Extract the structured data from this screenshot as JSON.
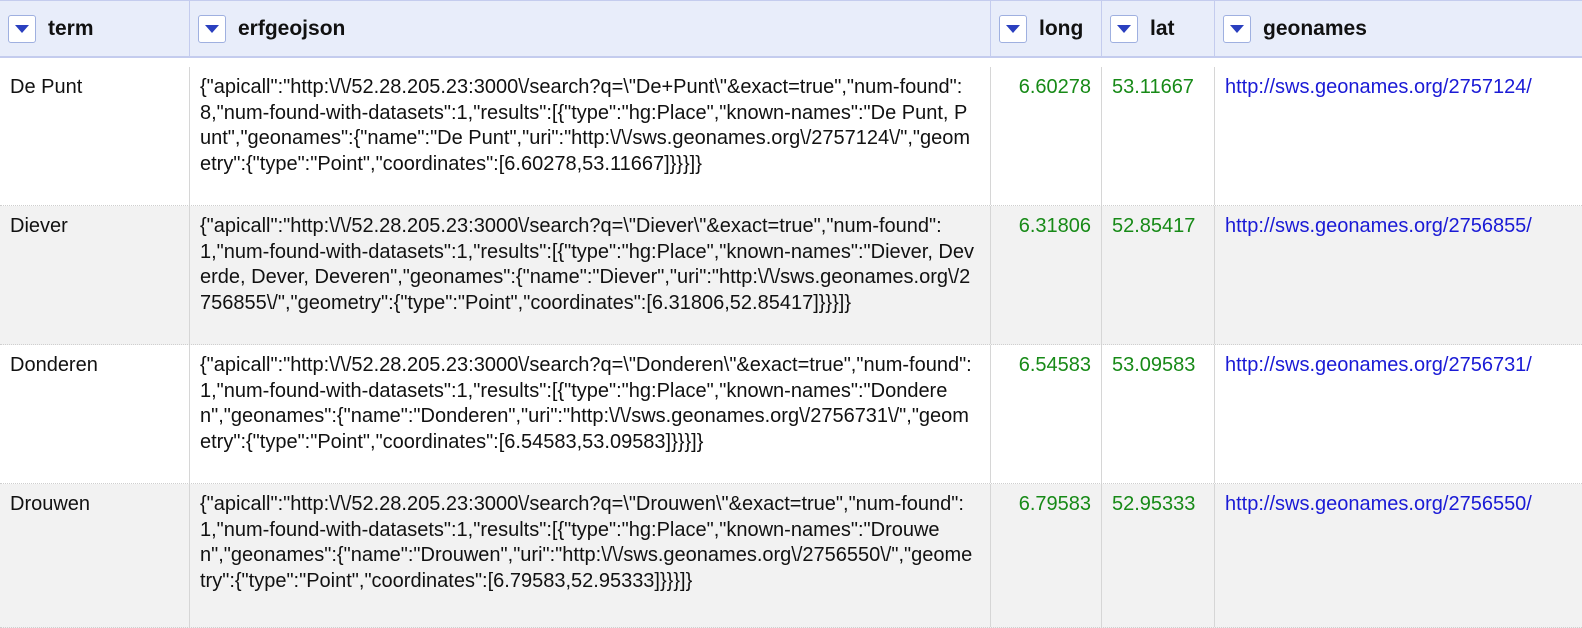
{
  "columns": [
    {
      "label": "term"
    },
    {
      "label": "erfgeojson"
    },
    {
      "label": "long"
    },
    {
      "label": "lat"
    },
    {
      "label": "geonames"
    }
  ],
  "rows": [
    {
      "term": "De Punt",
      "erfgeojson": "{\"apicall\":\"http:\\/\\/52.28.205.23:3000\\/search?q=\\\"De+Punt\\\"&exact=true\",\"num-found\":8,\"num-found-with-datasets\":1,\"results\":[{\"type\":\"hg:Place\",\"known-names\":\"De Punt, Punt\",\"geonames\":{\"name\":\"De Punt\",\"uri\":\"http:\\/\\/sws.geonames.org\\/2757124\\/\",\"geometry\":{\"type\":\"Point\",\"coordinates\":[6.60278,53.11667]}}}]}",
      "long": "6.60278",
      "lat": "53.11667",
      "geonames": "http://sws.geonames.org/2757124/"
    },
    {
      "term": "Diever",
      "erfgeojson": "{\"apicall\":\"http:\\/\\/52.28.205.23:3000\\/search?q=\\\"Diever\\\"&exact=true\",\"num-found\":1,\"num-found-with-datasets\":1,\"results\":[{\"type\":\"hg:Place\",\"known-names\":\"Diever, Deverde, Dever, Deveren\",\"geonames\":{\"name\":\"Diever\",\"uri\":\"http:\\/\\/sws.geonames.org\\/2756855\\/\",\"geometry\":{\"type\":\"Point\",\"coordinates\":[6.31806,52.85417]}}}]}",
      "long": "6.31806",
      "lat": "52.85417",
      "geonames": "http://sws.geonames.org/2756855/"
    },
    {
      "term": "Donderen",
      "erfgeojson": "{\"apicall\":\"http:\\/\\/52.28.205.23:3000\\/search?q=\\\"Donderen\\\"&exact=true\",\"num-found\":1,\"num-found-with-datasets\":1,\"results\":[{\"type\":\"hg:Place\",\"known-names\":\"Donderen\",\"geonames\":{\"name\":\"Donderen\",\"uri\":\"http:\\/\\/sws.geonames.org\\/2756731\\/\",\"geometry\":{\"type\":\"Point\",\"coordinates\":[6.54583,53.09583]}}}]}",
      "long": "6.54583",
      "lat": "53.09583",
      "geonames": "http://sws.geonames.org/2756731/"
    },
    {
      "term": "Drouwen",
      "erfgeojson": "{\"apicall\":\"http:\\/\\/52.28.205.23:3000\\/search?q=\\\"Drouwen\\\"&exact=true\",\"num-found\":1,\"num-found-with-datasets\":1,\"results\":[{\"type\":\"hg:Place\",\"known-names\":\"Drouwen\",\"geonames\":{\"name\":\"Drouwen\",\"uri\":\"http:\\/\\/sws.geonames.org\\/2756550\\/\",\"geometry\":{\"type\":\"Point\",\"coordinates\":[6.79583,52.95333]}}}]}",
      "long": "6.79583",
      "lat": "52.95333",
      "geonames": "http://sws.geonames.org/2756550/"
    }
  ],
  "colors": {
    "header_bg": "#e8edfa",
    "menu_arrow": "#2a3fbf",
    "number": "#178a17",
    "link": "#1a1ad6",
    "row_alt": "#f2f2f2"
  },
  "icons": {
    "column_menu": "triangle-down-icon"
  }
}
